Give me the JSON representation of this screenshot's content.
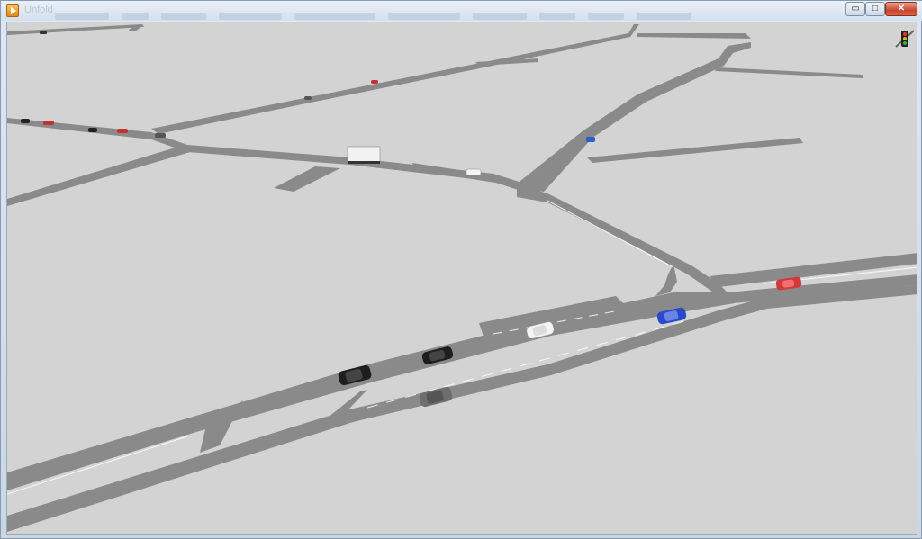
{
  "window": {
    "title": "Unfold",
    "controls": {
      "minimize": "▭",
      "maximize": "□",
      "close": "✕"
    }
  },
  "viewport": {
    "background": "#d3d3d3",
    "road_color": "#8a8a8a",
    "lane_marking_color": "#ffffff"
  },
  "toolbar": {
    "traffic_light_icon": "traffic-light-icon"
  },
  "vehicles": [
    {
      "name": "car-black-1",
      "color": "#1e1e1e"
    },
    {
      "name": "car-black-2",
      "color": "#1e1e1e"
    },
    {
      "name": "car-gray",
      "color": "#6e6e6e"
    },
    {
      "name": "car-white",
      "color": "#f4f4f4"
    },
    {
      "name": "car-blue",
      "color": "#2a48c8"
    },
    {
      "name": "car-red",
      "color": "#d23a3a"
    },
    {
      "name": "truck-white",
      "color": "#f2f2f2"
    }
  ]
}
